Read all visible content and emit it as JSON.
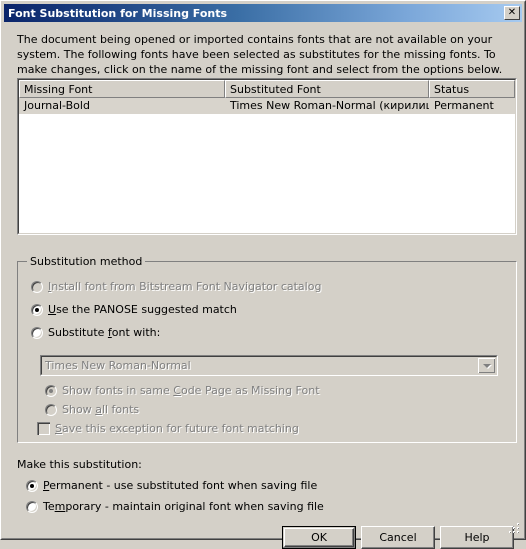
{
  "window": {
    "title": "Font Substitution for Missing Fonts",
    "close_label": "✕"
  },
  "intro": {
    "text": "The document being opened or imported contains fonts that are not available on your system.  The following fonts have been selected as substitutes for the missing fonts.  To make changes, click on the name of the missing font and select from the options below."
  },
  "listview": {
    "columns": [
      "Missing Font",
      "Substituted Font",
      "Status"
    ],
    "rows": [
      {
        "missing_font": "Journal-Bold",
        "substituted_font": "Times New Roman-Normal (кирилица)",
        "status": "Permanent"
      }
    ]
  },
  "substitution_method": {
    "group_title": "Substitution method",
    "options": [
      {
        "label": "Install font from Bitstream Font Navigator catalog",
        "mnemonic": "I",
        "checked": false,
        "disabled": true
      },
      {
        "label": "Use the PANOSE suggested match",
        "mnemonic": "U",
        "checked": true,
        "disabled": false
      },
      {
        "label": "Substitute font with:",
        "mnemonic": "f",
        "checked": false,
        "disabled": false
      }
    ],
    "font_combo": {
      "value": "Times New Roman-Normal",
      "disabled": true,
      "arrow_icon": "chevron-down-icon"
    },
    "scope_options": [
      {
        "label": "Show fonts in same Code Page as Missing Font",
        "mnemonic": "C",
        "checked": true,
        "disabled": true
      },
      {
        "label": "Show all fonts",
        "mnemonic": "a",
        "checked": false,
        "disabled": true
      }
    ],
    "save_exception": {
      "label": "Save this exception for future font matching",
      "mnemonic": "S",
      "checked": false,
      "disabled": true
    }
  },
  "make_substitution": {
    "label": "Make this substitution:",
    "options": [
      {
        "label": "Permanent - use substituted font when saving file",
        "mnemonic": "P",
        "checked": true,
        "disabled": false
      },
      {
        "label": "Temporary - maintain original font when saving file",
        "mnemonic": "m",
        "checked": false,
        "disabled": false
      }
    ]
  },
  "buttons": {
    "ok": "OK",
    "cancel": "Cancel",
    "help": "Help"
  },
  "colors": {
    "face": "#d4d0c8",
    "title_gradient_start": "#0a246a",
    "title_gradient_end": "#a6caf0",
    "title_text": "#ffffff",
    "disabled_text": "#808080",
    "row_selected": "#d8d4cc"
  }
}
